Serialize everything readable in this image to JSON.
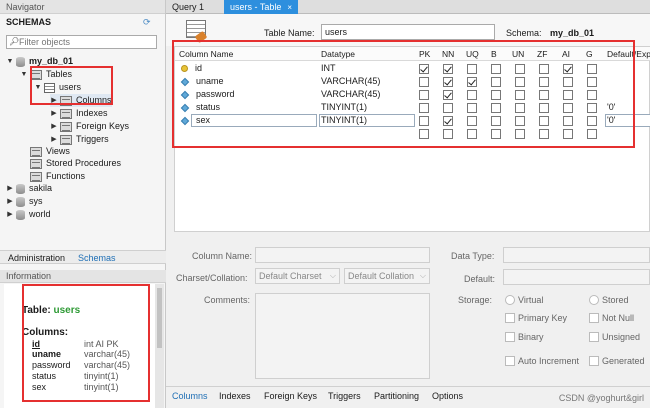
{
  "navigator": {
    "title": "Navigator",
    "schemas_header": "SCHEMAS",
    "filter_placeholder": "Filter objects",
    "tree": {
      "db1": "my_db_01",
      "tables": "Tables",
      "users": "users",
      "columns": "Columns",
      "indexes": "Indexes",
      "foreign_keys": "Foreign Keys",
      "triggers": "Triggers",
      "views": "Views",
      "stored_procedures": "Stored Procedures",
      "functions": "Functions",
      "sakila": "sakila",
      "sys": "sys",
      "world": "world"
    },
    "tabs": {
      "administration": "Administration",
      "schemas": "Schemas"
    },
    "info_header": "Information",
    "info": {
      "table_label": "Table:",
      "table_name": "users",
      "columns_label": "Columns:",
      "columns": [
        {
          "name": "id",
          "type": "int AI PK"
        },
        {
          "name": "uname",
          "type": "varchar(45)"
        },
        {
          "name": "password",
          "type": "varchar(45)"
        },
        {
          "name": "status",
          "type": "tinyint(1)"
        },
        {
          "name": "sex",
          "type": "tinyint(1)"
        }
      ]
    }
  },
  "tabs": {
    "query": "Query 1",
    "table": "users - Table",
    "close": "×"
  },
  "editor": {
    "table_name_label": "Table Name:",
    "table_name": "users",
    "schema_label": "Schema:",
    "schema": "my_db_01"
  },
  "grid": {
    "headers": [
      "Column Name",
      "Datatype",
      "PK",
      "NN",
      "UQ",
      "B",
      "UN",
      "ZF",
      "AI",
      "G",
      "Default/Exp"
    ],
    "rows": [
      {
        "name": "id",
        "type": "INT",
        "flags": [
          1,
          1,
          0,
          0,
          0,
          0,
          1,
          0
        ],
        "default": "",
        "key": true
      },
      {
        "name": "uname",
        "type": "VARCHAR(45)",
        "flags": [
          0,
          1,
          1,
          0,
          0,
          0,
          0,
          0
        ],
        "default": "",
        "key": false
      },
      {
        "name": "password",
        "type": "VARCHAR(45)",
        "flags": [
          0,
          1,
          0,
          0,
          0,
          0,
          0,
          0
        ],
        "default": "",
        "key": false
      },
      {
        "name": "status",
        "type": "TINYINT(1)",
        "flags": [
          0,
          0,
          0,
          0,
          0,
          0,
          0,
          0
        ],
        "default": "'0'",
        "key": false
      },
      {
        "name": "sex",
        "type": "TINYINT(1)",
        "flags": [
          0,
          1,
          0,
          0,
          0,
          0,
          0,
          0
        ],
        "default": "'0'",
        "key": false
      },
      {
        "name": "",
        "type": "",
        "flags": [
          0,
          0,
          0,
          0,
          0,
          0,
          0,
          0
        ],
        "default": "",
        "key": false
      }
    ]
  },
  "detail": {
    "column_name_label": "Column Name:",
    "data_type_label": "Data Type:",
    "charset_label": "Charset/Collation:",
    "default_charset": "Default Charset",
    "default_collation": "Default Collation",
    "default_label": "Default:",
    "comments_label": "Comments:",
    "storage_label": "Storage:",
    "virtual": "Virtual",
    "stored": "Stored",
    "primary_key": "Primary Key",
    "not_null": "Not Null",
    "binary": "Binary",
    "unsigned": "Unsigned",
    "auto_increment": "Auto Increment",
    "generated": "Generated"
  },
  "bottom_tabs": [
    "Columns",
    "Indexes",
    "Foreign Keys",
    "Triggers",
    "Partitioning",
    "Options"
  ],
  "watermark": "CSDN @yoghurt&girl"
}
